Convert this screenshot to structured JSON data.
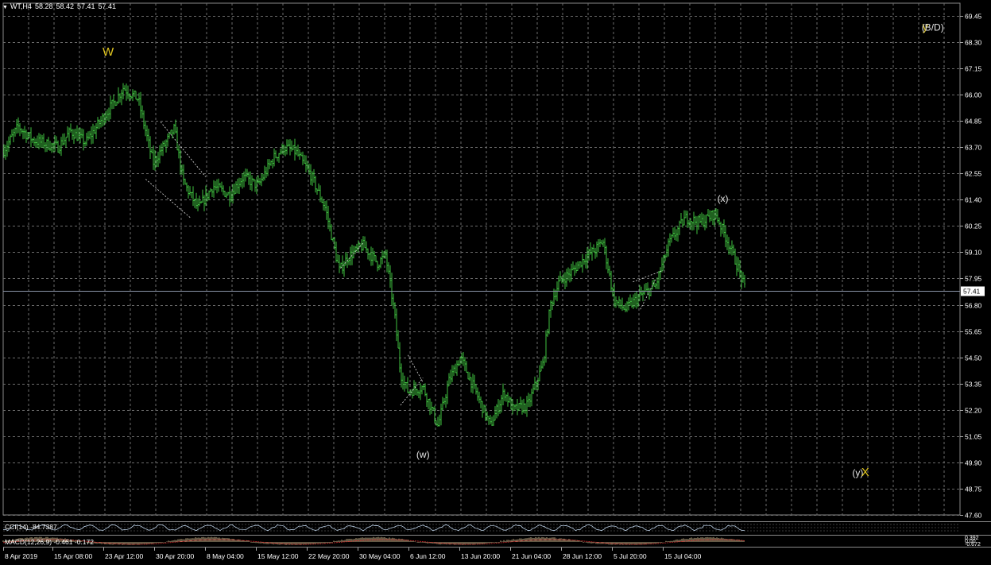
{
  "header": {
    "symbol": "WT,H4",
    "open": "58.28",
    "high": "58.42",
    "low": "57.41",
    "close": "57.41"
  },
  "colors": {
    "background": "#000000",
    "candles": "#41c241",
    "grid": "#6b6b6b",
    "wave_major": "#e3c821",
    "wave_minor": "#e6e6e6",
    "price_line": "#8a94a8",
    "macd_hist": "#c9b28a",
    "macd_signal": "#d83030"
  },
  "chart_data": [
    {
      "type": "candlestick",
      "symbol": "WT",
      "timeframe": "H4",
      "y_ticks": [
        69.45,
        68.3,
        67.15,
        66.0,
        64.85,
        63.7,
        62.55,
        61.4,
        60.25,
        59.1,
        57.95,
        56.8,
        55.65,
        54.5,
        53.35,
        52.2,
        51.05,
        49.9,
        48.75,
        47.6
      ],
      "ylim": [
        47.6,
        70.0
      ],
      "current_price": "57.41",
      "x_labels": [
        "8 Apr 2019",
        "15 Apr 08:00",
        "23 Apr 12:00",
        "30 Apr 20:00",
        "8 May 04:00",
        "15 May 12:00",
        "22 May 20:00",
        "30 May 04:00",
        "6 Jun 12:00",
        "13 Jun 20:00",
        "21 Jun 04:00",
        "28 Jun 12:00",
        "5 Jul 20:00",
        "15 Jul 04:00"
      ],
      "approx_path": [
        {
          "x": "8 Apr 2019",
          "y": 63.5
        },
        {
          "x": "10 Apr",
          "y": 64.6
        },
        {
          "x": "12 Apr",
          "y": 64.0
        },
        {
          "x": "15 Apr 08:00",
          "y": 63.7
        },
        {
          "x": "17 Apr",
          "y": 64.4
        },
        {
          "x": "19 Apr",
          "y": 63.9
        },
        {
          "x": "23 Apr 12:00",
          "y": 66.0
        },
        {
          "x": "24 Apr",
          "y": 66.3
        },
        {
          "x": "26 Apr",
          "y": 65.8
        },
        {
          "x": "28 Apr",
          "y": 63.0
        },
        {
          "x": "30 Apr 20:00",
          "y": 64.5
        },
        {
          "x": "2 May",
          "y": 62.2
        },
        {
          "x": "4 May",
          "y": 61.0
        },
        {
          "x": "6 May",
          "y": 62.0
        },
        {
          "x": "8 May 04:00",
          "y": 61.6
        },
        {
          "x": "10 May",
          "y": 62.4
        },
        {
          "x": "12 May",
          "y": 62.0
        },
        {
          "x": "14 May",
          "y": 63.2
        },
        {
          "x": "15 May 12:00",
          "y": 63.7
        },
        {
          "x": "17 May",
          "y": 63.5
        },
        {
          "x": "19 May",
          "y": 62.5
        },
        {
          "x": "21 May",
          "y": 61.0
        },
        {
          "x": "22 May 20:00",
          "y": 58.3
        },
        {
          "x": "24 May",
          "y": 58.9
        },
        {
          "x": "26 May",
          "y": 59.4
        },
        {
          "x": "28 May",
          "y": 58.6
        },
        {
          "x": "29 May",
          "y": 59.0
        },
        {
          "x": "30 May 04:00",
          "y": 56.5
        },
        {
          "x": "31 May",
          "y": 53.8
        },
        {
          "x": "1 Jun",
          "y": 53.0
        },
        {
          "x": "3 Jun",
          "y": 53.2
        },
        {
          "x": "5 Jun",
          "y": 51.5
        },
        {
          "x": "6 Jun 12:00",
          "y": 53.5
        },
        {
          "x": "8 Jun",
          "y": 54.5
        },
        {
          "x": "10 Jun",
          "y": 53.0
        },
        {
          "x": "12 Jun",
          "y": 51.5
        },
        {
          "x": "13 Jun 20:00",
          "y": 53.0
        },
        {
          "x": "15 Jun",
          "y": 52.2
        },
        {
          "x": "17 Jun",
          "y": 52.4
        },
        {
          "x": "19 Jun",
          "y": 54.2
        },
        {
          "x": "20 Jun",
          "y": 56.8
        },
        {
          "x": "21 Jun 04:00",
          "y": 57.8
        },
        {
          "x": "23 Jun",
          "y": 58.3
        },
        {
          "x": "25 Jun",
          "y": 59.0
        },
        {
          "x": "26 Jun",
          "y": 59.2
        },
        {
          "x": "27 Jun",
          "y": 59.6
        },
        {
          "x": "28 Jun 12:00",
          "y": 57.0
        },
        {
          "x": "30 Jun",
          "y": 56.6
        },
        {
          "x": "2 Jul",
          "y": 57.2
        },
        {
          "x": "4 Jul",
          "y": 57.6
        },
        {
          "x": "5 Jul 20:00",
          "y": 59.5
        },
        {
          "x": "8 Jul",
          "y": 60.6
        },
        {
          "x": "10 Jul",
          "y": 60.4
        },
        {
          "x": "12 Jul",
          "y": 60.8
        },
        {
          "x": "14 Jul",
          "y": 59.3
        },
        {
          "x": "15 Jul 04:00",
          "y": 58.3
        },
        {
          "x": "16 Jul",
          "y": 57.41
        }
      ],
      "wave_labels": [
        {
          "text": "W",
          "class": "major",
          "x": "22 Apr",
          "y": 67.7
        },
        {
          "text": "(w)",
          "class": "minor",
          "x": "3 Jun",
          "y": 50.1
        },
        {
          "text": "(x)",
          "class": "minor",
          "x": "13 Jul",
          "y": 61.3
        },
        {
          "text": "(y)",
          "class": "minor",
          "x": "31 Jul",
          "y": 49.3
        },
        {
          "text": "X",
          "class": "major",
          "x": "1 Aug",
          "y": 49.3
        },
        {
          "text": "y",
          "class": "major",
          "x": "9 Aug",
          "y": 68.8
        },
        {
          "text": "(B/D)",
          "class": "minor",
          "x": "10 Aug",
          "y": 68.8
        }
      ]
    },
    {
      "type": "line",
      "name": "CCI(14) -84.7387",
      "label": "CCI(14) -84.7387"
    },
    {
      "type": "bar",
      "name": "MACD(12,26,9) -0.461 -0.172",
      "label": "MACD(12,26,9) -0.461 -0.172",
      "axis_values": [
        "0.392",
        "0.00",
        "-0.672"
      ]
    }
  ]
}
